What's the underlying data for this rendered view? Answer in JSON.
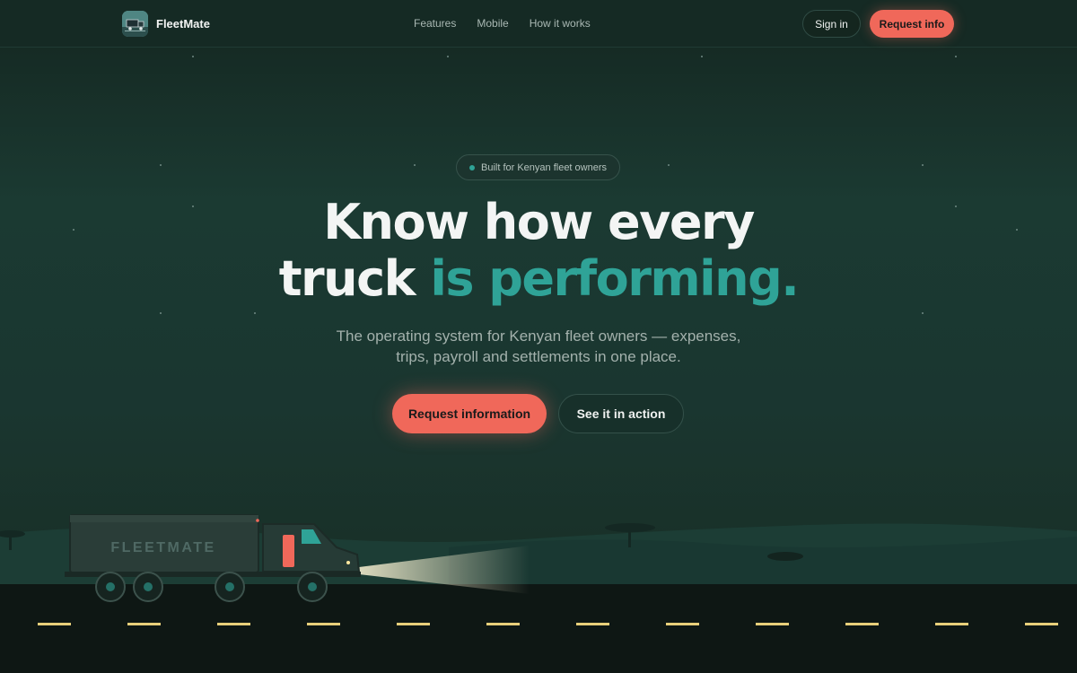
{
  "nav": {
    "brand_name": "FleetMate",
    "links": [
      "Features",
      "Mobile",
      "How it works"
    ],
    "sign_in_label": "Sign in",
    "request_label": "Request info"
  },
  "hero": {
    "badge_text": "Built for Kenyan fleet owners",
    "headline_line1": "Know how every",
    "headline_line2_plain": "truck",
    "headline_line2_accent": "is performing.",
    "subtitle_line1": "The operating system for Kenyan fleet owners — expenses,",
    "subtitle_line2": "trips, payroll and settlements in one place.",
    "primary_cta": "Request information",
    "secondary_cta": "See it in action"
  },
  "scene": {
    "truck_label": "FLEETMATE"
  },
  "colors": {
    "accent": "#2fa397",
    "brand_coral": "#f0685a",
    "background": "#1b3a32",
    "road": "#0e1714",
    "lane_marking": "#e8cf7a"
  },
  "icons": {
    "logo": "truck-logo-icon",
    "badge": "status-dot-icon"
  }
}
